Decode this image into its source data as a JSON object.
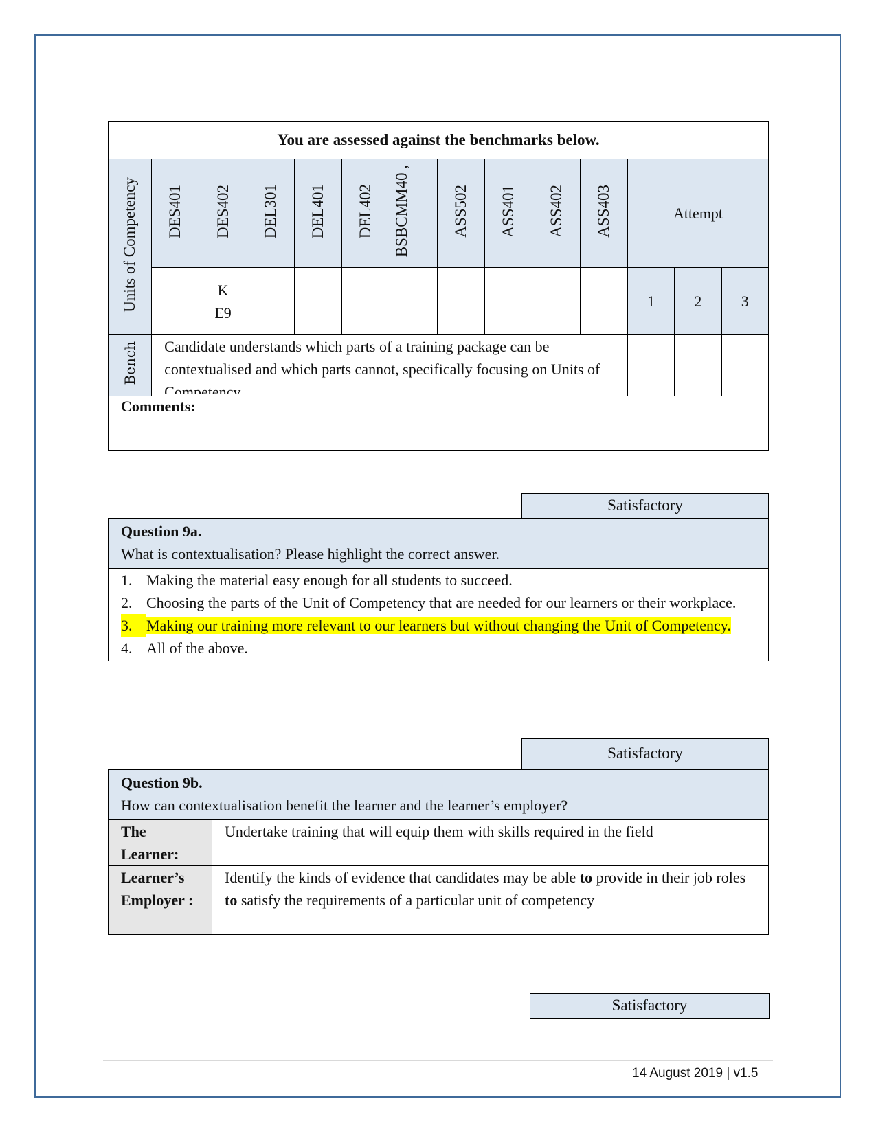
{
  "benchmark_table": {
    "title": "You are assessed against the benchmarks below.",
    "row_label": "Units of Competency",
    "units": [
      {
        "code": "DES401",
        "value": ""
      },
      {
        "code": "DES402",
        "value": "K E9"
      },
      {
        "code": "DEL301",
        "value": ""
      },
      {
        "code": "DEL401",
        "value": ""
      },
      {
        "code": "DEL402",
        "value": ""
      },
      {
        "code": "BSBCMM40 ,",
        "value": ""
      },
      {
        "code": "ASS502",
        "value": ""
      },
      {
        "code": "ASS401",
        "value": ""
      },
      {
        "code": "ASS402",
        "value": ""
      },
      {
        "code": "ASS403",
        "value": ""
      }
    ],
    "des402_value_line1": "K",
    "des402_value_line2": "E9",
    "attempt_label": "Attempt",
    "attempts": [
      "1",
      "2",
      "3"
    ],
    "bench_label": "Bench",
    "bench_text": "Candidate understands which parts of a training package can be contextualised and which parts cannot, specifically focusing on Units of Competency.",
    "comments_label": "Comments:",
    "comments_value": ""
  },
  "question_9a": {
    "status": "Satisfactory",
    "number": "Question 9a.",
    "prompt": "What is contextualisation? Please highlight the correct answer.",
    "options": [
      {
        "num": "1.",
        "text": "Making the material easy enough for all students to succeed.",
        "highlighted": false
      },
      {
        "num": "2.",
        "text": "Choosing the parts of the Unit of Competency that are needed for our learners or their workplace.",
        "highlighted": false
      },
      {
        "num": "3.",
        "text": "Making our training more relevant to our learners but without changing the Unit of Competency.",
        "highlighted": true
      },
      {
        "num": "4.",
        "text": "All of the above.",
        "highlighted": false
      }
    ]
  },
  "question_9b": {
    "status": "Satisfactory",
    "number": "Question 9b.",
    "prompt": "How can contextualisation benefit the learner and the learner’s employer?",
    "rows": [
      {
        "label": "The Learner:",
        "answer": "Undertake training that will equip them with skills required in the field"
      },
      {
        "label": "Learner’s Employer :",
        "answer_part1": "Identify the kinds of evidence that candidates may be able ",
        "answer_bold1": "to",
        "answer_part2": " provide in their job roles ",
        "answer_bold2": "to",
        "answer_part3": " satisfy the requirements of a particular unit of competency"
      }
    ]
  },
  "next_status": "Satisfactory",
  "footer": {
    "date": "14 August 2019",
    "separator": "|",
    "version": "v1.5"
  },
  "colors": {
    "page_border": "#3f6a9a",
    "header_fill": "#dce6f1",
    "label_fill": "#e6e6e6",
    "highlight": "#ffff00"
  }
}
